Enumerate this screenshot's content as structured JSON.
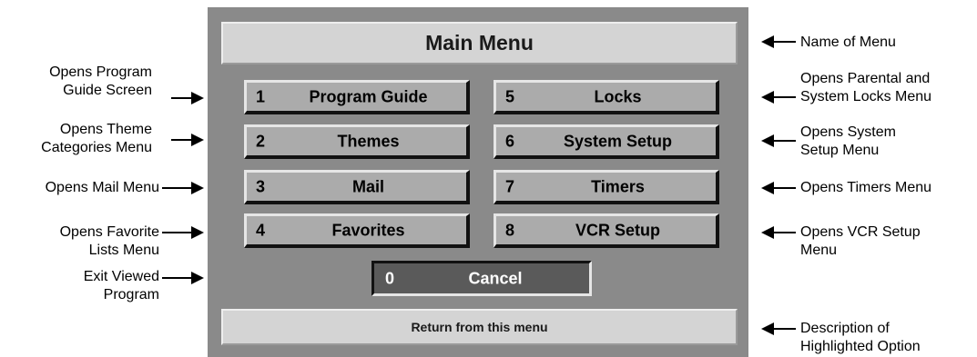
{
  "menu": {
    "title": "Main Menu",
    "description": "Return from this menu",
    "options": [
      {
        "number": "1",
        "label": "Program Guide"
      },
      {
        "number": "2",
        "label": "Themes"
      },
      {
        "number": "3",
        "label": "Mail"
      },
      {
        "number": "4",
        "label": "Favorites"
      },
      {
        "number": "5",
        "label": "Locks"
      },
      {
        "number": "6",
        "label": "System Setup"
      },
      {
        "number": "7",
        "label": "Timers"
      },
      {
        "number": "8",
        "label": "VCR Setup"
      }
    ],
    "cancel": {
      "number": "0",
      "label": "Cancel"
    }
  },
  "callouts": {
    "left": [
      {
        "line1": "Opens Program",
        "line2": "Guide Screen"
      },
      {
        "line1": "Opens Theme",
        "line2": "Categories Menu"
      },
      {
        "line1": "Opens Mail Menu",
        "line2": ""
      },
      {
        "line1": "Opens Favorite",
        "line2": "Lists Menu"
      },
      {
        "line1": "Exit Viewed",
        "line2": "Program"
      }
    ],
    "right": [
      {
        "line1": "Name of Menu",
        "line2": ""
      },
      {
        "line1": "Opens Parental and",
        "line2": "System Locks Menu"
      },
      {
        "line1": "Opens System",
        "line2": "Setup Menu"
      },
      {
        "line1": "Opens Timers Menu",
        "line2": ""
      },
      {
        "line1": "Opens VCR Setup",
        "line2": "Menu"
      },
      {
        "line1": "Description of",
        "line2": "Highlighted Option"
      }
    ]
  }
}
